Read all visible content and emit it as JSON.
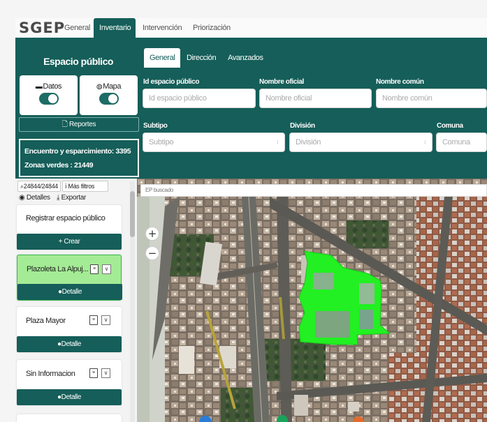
{
  "app": {
    "logo": "SGEP"
  },
  "top_tabs": [
    {
      "label": "General"
    },
    {
      "label": "Inventario",
      "active": true
    },
    {
      "label": "Intervención"
    },
    {
      "label": "Priorización"
    }
  ],
  "left_panel": {
    "title": "Espacio público",
    "datos_label": "Datos",
    "mapa_label": "Mapa",
    "datos_on": true,
    "mapa_on": true,
    "reportes_label": "Reportes",
    "summary_line1": "Encuentro y esparcimiento: 3395",
    "summary_line2": "Zonas verdes : 21449"
  },
  "sub_tabs": [
    {
      "label": "General",
      "active": true
    },
    {
      "label": "Dirección"
    },
    {
      "label": "Avanzados"
    }
  ],
  "filters": {
    "id_label": "Id espacio público",
    "id_placeholder": "Id espacio público",
    "oficial_label": "Nombre oficial",
    "oficial_placeholder": "Nombre oficial",
    "comun_label": "Nombre común",
    "comun_placeholder": "Nombre común",
    "subtipo_label": "Subtipo",
    "subtipo_placeholder": "Subtipo",
    "division_label": "División",
    "division_placeholder": "División",
    "comuna_label": "Comuna",
    "comuna_placeholder": "Comuna"
  },
  "list": {
    "count": "24844/24844",
    "more_filters": "Más filtros",
    "details": "Detalles",
    "export": "Exportar",
    "register_label": "Registrar espacio público",
    "create_label": "+ Crear",
    "items": [
      {
        "name": "Plazoleta La Alpuj...",
        "detail": "Detalle",
        "selected": true
      },
      {
        "name": "Plaza Mayor",
        "detail": "Detalle"
      },
      {
        "name": "Sin Informacion",
        "detail": "Detalle"
      }
    ]
  },
  "map": {
    "search_placeholder": "EP buscado",
    "zoom_in": "+",
    "zoom_out": "−",
    "highlight_color": "#22f022"
  },
  "colors": {
    "primary": "#155e59",
    "selected_card": "#a4eb95",
    "highlight": "#22f022"
  }
}
